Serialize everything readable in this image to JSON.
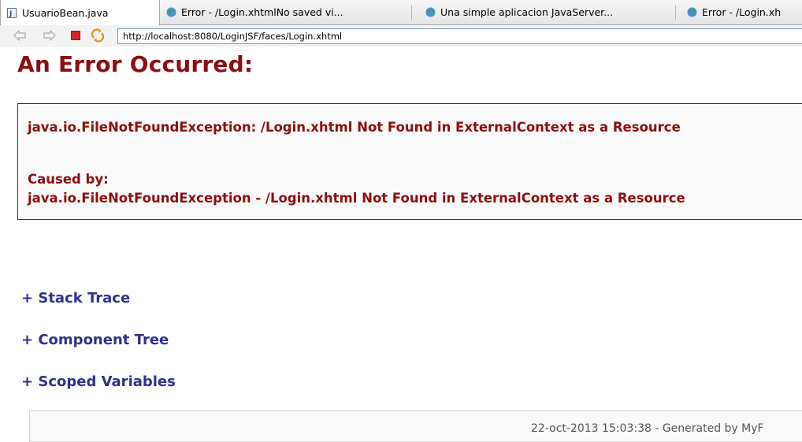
{
  "browser": {
    "tabs": [
      {
        "label": "UsuarioBean.java",
        "icon": "java-file-icon"
      },
      {
        "label": "Error - /Login.xhtmlNo saved vi...",
        "icon": "globe-icon"
      },
      {
        "label": "Una simple aplicacion JavaServer...",
        "icon": "globe-icon"
      },
      {
        "label": "Error - /Login.xh",
        "icon": "globe-icon"
      }
    ],
    "url": "http://localhost:8080/LoginJSF/faces/Login.xhtml",
    "colors": {
      "stop": "#d9262a",
      "refresh": "#e39a1a",
      "arrow": "#b9bec6"
    }
  },
  "page": {
    "title": "An Error Occurred:",
    "error_message": "java.io.FileNotFoundException: /Login.xhtml Not Found in ExternalContext as a Resource",
    "caused_by_label": "Caused by:",
    "caused_by_detail": "java.io.FileNotFoundException - /Login.xhtml Not Found in ExternalContext as a Resource",
    "toggles": {
      "stack_trace": "+ Stack Trace",
      "component_tree": "+ Component Tree",
      "scoped_variables": "+ Scoped Variables"
    },
    "footer": "22-oct-2013 15:03:38 - Generated by MyF",
    "colors": {
      "error": "#8b0f0f",
      "link": "#30308b"
    }
  }
}
